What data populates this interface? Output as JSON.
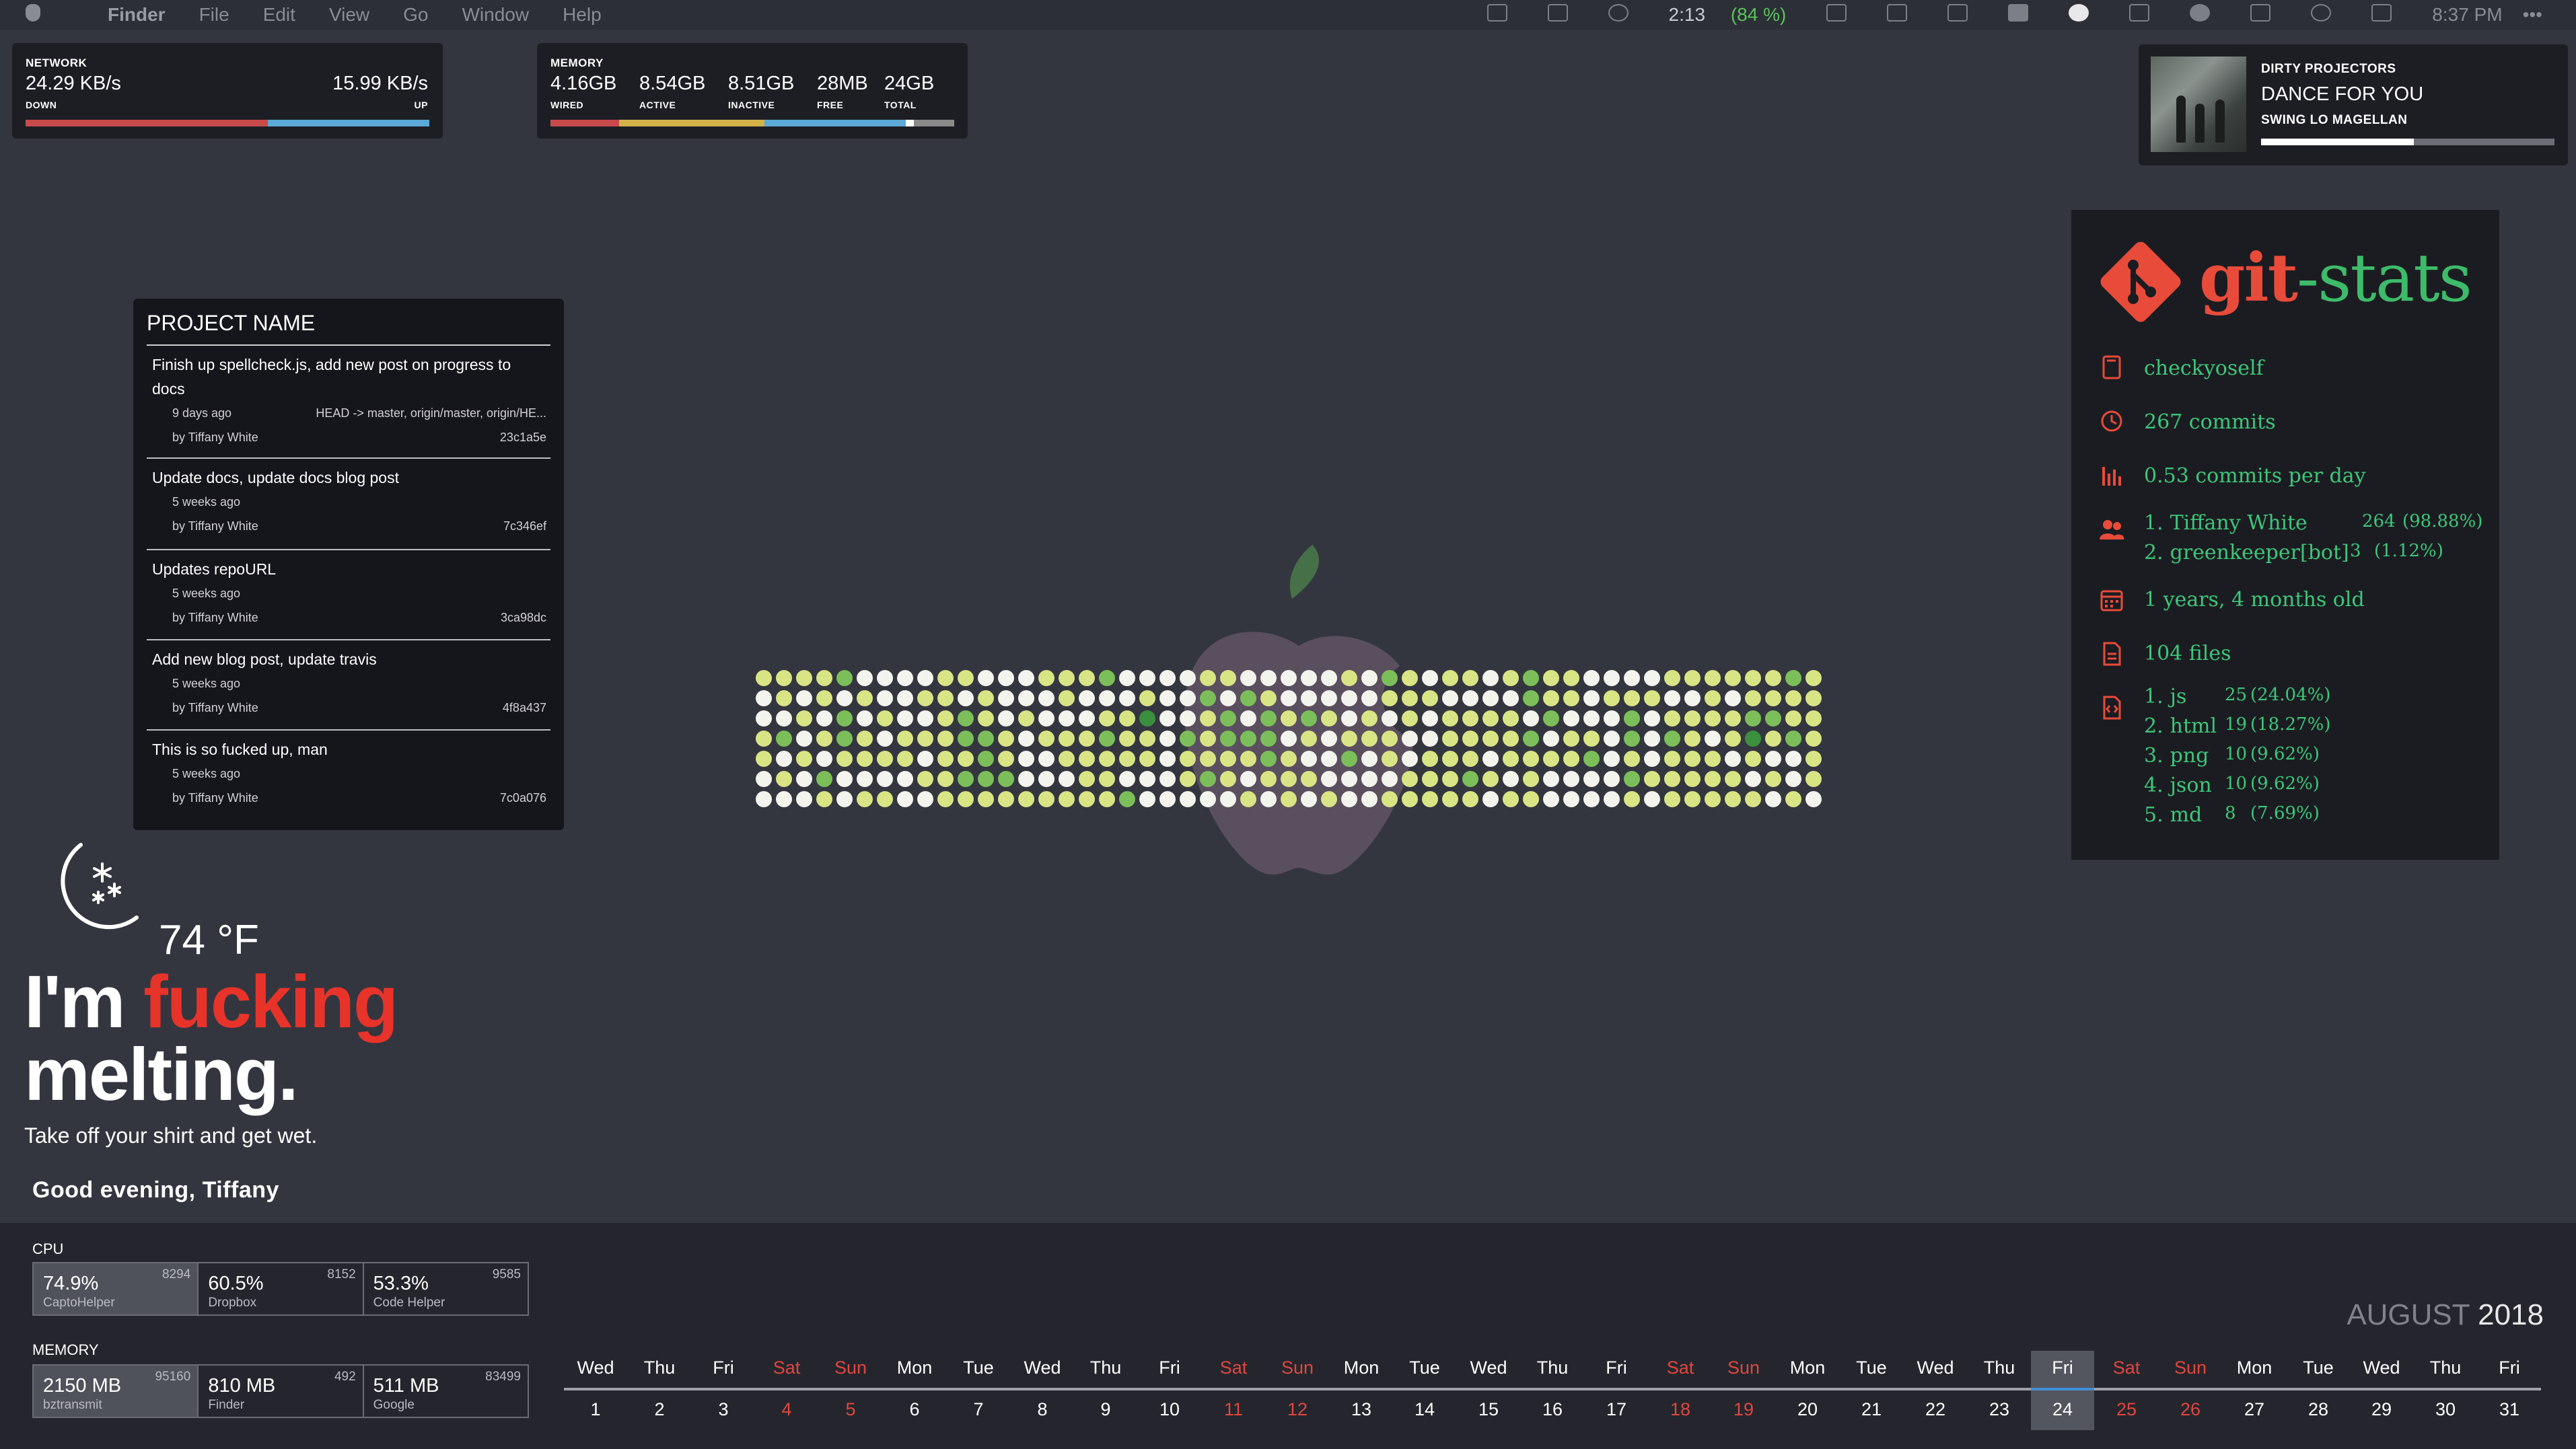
{
  "menubar": {
    "app": "Finder",
    "menus": [
      "File",
      "Edit",
      "View",
      "Go",
      "Window",
      "Help"
    ],
    "battery_time": "2:13",
    "battery_pct": "(84 %)",
    "clock": "8:37 PM",
    "more": "•••"
  },
  "network": {
    "label": "NETWORK",
    "down_value": "24.29 KB/s",
    "up_value": "15.99 KB/s",
    "down_label": "DOWN",
    "up_label": "UP",
    "down_share": 0.6,
    "colors": {
      "down": "#c94a4a",
      "up": "#5aa9d6"
    }
  },
  "memory": {
    "label": "MEMORY",
    "items": [
      {
        "value": "4.16GB",
        "label": "WIRED",
        "share": 0.17,
        "color": "#c94a4a"
      },
      {
        "value": "8.54GB",
        "label": "ACTIVE",
        "share": 0.36,
        "color": "#d4b24a"
      },
      {
        "value": "8.51GB",
        "label": "INACTIVE",
        "share": 0.35,
        "color": "#5aa9d6"
      },
      {
        "value": "28MB",
        "label": "FREE",
        "share": 0.02,
        "color": "#ffffff"
      },
      {
        "value": "24GB",
        "label": "TOTAL",
        "share": 0.1,
        "color": "#8a8a8a"
      }
    ]
  },
  "now_playing": {
    "artist": "DIRTY PROJECTORS",
    "track": "DANCE FOR YOU",
    "album": "SWING LO MAGELLAN",
    "progress": 0.52
  },
  "project": {
    "title": "PROJECT NAME",
    "commits": [
      {
        "message": "Finish up spellcheck.js, add new post on progress to docs",
        "when": "9 days ago",
        "refs": "HEAD -> master, origin/master, origin/HE...",
        "author": "by Tiffany White",
        "hash": "23c1a5e"
      },
      {
        "message": "Update docs, update docs blog post",
        "when": "5 weeks ago",
        "refs": "",
        "author": "by Tiffany White",
        "hash": "7c346ef"
      },
      {
        "message": "Updates repoURL",
        "when": "5 weeks ago",
        "refs": "",
        "author": "by Tiffany White",
        "hash": "3ca98dc"
      },
      {
        "message": "Add new blog post, update travis",
        "when": "5 weeks ago",
        "refs": "",
        "author": "by Tiffany White",
        "hash": "4f8a437"
      },
      {
        "message": "This is so fucked up, man",
        "when": "5 weeks ago",
        "refs": "",
        "author": "by Tiffany White",
        "hash": "7c0a076"
      }
    ]
  },
  "weather": {
    "icon": "moon-snow-icon",
    "temp": "74 °F",
    "headline_1": "I'm",
    "headline_red": "fucking",
    "headline_2": "melting.",
    "tagline": "Take off your shirt and get wet."
  },
  "greeting": "Good evening, Tiffany",
  "cpu": {
    "label": "CPU",
    "procs": [
      {
        "pct": "74.9%",
        "name": "CaptoHelper",
        "pid": "8294"
      },
      {
        "pct": "60.5%",
        "name": "Dropbox",
        "pid": "8152"
      },
      {
        "pct": "53.3%",
        "name": "Code Helper",
        "pid": "9585"
      }
    ]
  },
  "mem_procs": {
    "label": "MEMORY",
    "procs": [
      {
        "pct": "2150 MB",
        "name": "bztransmit",
        "pid": "95160"
      },
      {
        "pct": "810 MB",
        "name": "Finder",
        "pid": "492"
      },
      {
        "pct": "511 MB",
        "name": "Google",
        "pid": "83499"
      }
    ]
  },
  "calendar": {
    "month": "AUGUST",
    "year": "2018",
    "today": 24,
    "days": [
      [
        "Wed",
        1
      ],
      [
        "Thu",
        2
      ],
      [
        "Fri",
        3
      ],
      [
        "Sat",
        4
      ],
      [
        "Sun",
        5
      ],
      [
        "Mon",
        6
      ],
      [
        "Tue",
        7
      ],
      [
        "Wed",
        8
      ],
      [
        "Thu",
        9
      ],
      [
        "Fri",
        10
      ],
      [
        "Sat",
        11
      ],
      [
        "Sun",
        12
      ],
      [
        "Mon",
        13
      ],
      [
        "Tue",
        14
      ],
      [
        "Wed",
        15
      ],
      [
        "Thu",
        16
      ],
      [
        "Fri",
        17
      ],
      [
        "Sat",
        18
      ],
      [
        "Sun",
        19
      ],
      [
        "Mon",
        20
      ],
      [
        "Tue",
        21
      ],
      [
        "Wed",
        22
      ],
      [
        "Thu",
        23
      ],
      [
        "Fri",
        24
      ],
      [
        "Sat",
        25
      ],
      [
        "Sun",
        26
      ],
      [
        "Mon",
        27
      ],
      [
        "Tue",
        28
      ],
      [
        "Wed",
        29
      ],
      [
        "Thu",
        30
      ],
      [
        "Fri",
        31
      ]
    ]
  },
  "git_stats": {
    "title_1": "git",
    "title_2": "-stats",
    "repo": "checkyoself",
    "commits": "267 commits",
    "per_day": "0.53 commits per day",
    "contributors": [
      {
        "rank": "1.",
        "name": "Tiffany White",
        "count": "264",
        "pct": "(98.88%)"
      },
      {
        "rank": "2.",
        "name": "greenkeeper[bot]",
        "count": "3",
        "pct": "(1.12%)"
      }
    ],
    "age": "1 years, 4 months old",
    "files": "104 files",
    "types": [
      {
        "rank": "1.",
        "ext": "js",
        "count": "25",
        "pct": "(24.04%)"
      },
      {
        "rank": "2.",
        "ext": "html",
        "count": "19",
        "pct": "(18.27%)"
      },
      {
        "rank": "3.",
        "ext": "png",
        "count": "10",
        "pct": "(9.62%)"
      },
      {
        "rank": "4.",
        "ext": "json",
        "count": "10",
        "pct": "(9.62%)"
      },
      {
        "rank": "5.",
        "ext": "md",
        "count": "8",
        "pct": "(7.69%)"
      }
    ],
    "colors": {
      "accent": "#e84b3a",
      "text": "#3dc77a"
    }
  },
  "contributions": {
    "rows": 7,
    "cols": 53,
    "levels": [
      "11112000011000111200001100000102101101211000011111121",
      "01010100110100010001002021000001110000211011100101111",
      "00102010012101000113001202121010101111020002011112211",
      "12012101112210111211021222010111001111201102021013121",
      "10101111011210011111011112100201011101111201011101001",
      "01020000112220001100012101110000111210100002111110101",
      "00010110011111111120000010101001111101100001011111010"
    ],
    "colors": [
      "#f4f4ee",
      "#d9e485",
      "#7cbf5a",
      "#3c8f3e"
    ]
  }
}
